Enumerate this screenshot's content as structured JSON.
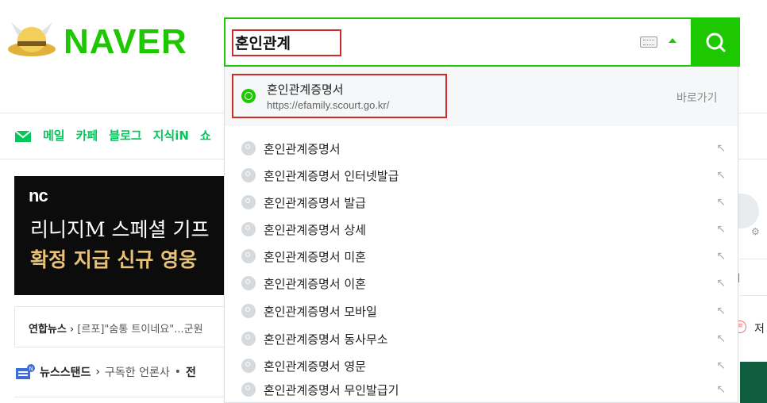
{
  "logo": {
    "text": "NAVER"
  },
  "nav": {
    "items": [
      "메일",
      "카페",
      "블로그",
      "지식iN",
      "쇼"
    ]
  },
  "banner": {
    "brand": "nc",
    "line1": "리니지M 스페셜 기프",
    "line2": "확정 지급 신규 영웅"
  },
  "news": {
    "source": "연합뉴스",
    "chevron": "›",
    "headline": "[르포]\"숨통 트이네요\"...군원"
  },
  "newsstand": {
    "title": "뉴스스탠드",
    "chevron": "›",
    "subscribed": "구독한 언론사",
    "bullet": "•",
    "cut": "전"
  },
  "search": {
    "value": "혼인관계",
    "accent": "#1ec800"
  },
  "shortcut": {
    "title": "혼인관계증명서",
    "url": "https://efamily.scourt.go.kr/",
    "action": "바로가기"
  },
  "suggestions": [
    "혼인관계증명서",
    "혼인관계증명서 인터넷발급",
    "혼인관계증명서 발급",
    "혼인관계증명서 상세",
    "혼인관계증명서 미혼",
    "혼인관계증명서 이혼",
    "혼인관계증명서 모바일",
    "혼인관계증명서 동사무소",
    "혼인관계증명서 영문",
    "혼인관계증명서 무인발급기"
  ],
  "suggestion_arrow": "↖",
  "right": {
    "label": "ㅣ",
    "text": "저"
  },
  "colors": {
    "brand_green": "#1ec800",
    "highlight_red": "#d02a2a"
  }
}
